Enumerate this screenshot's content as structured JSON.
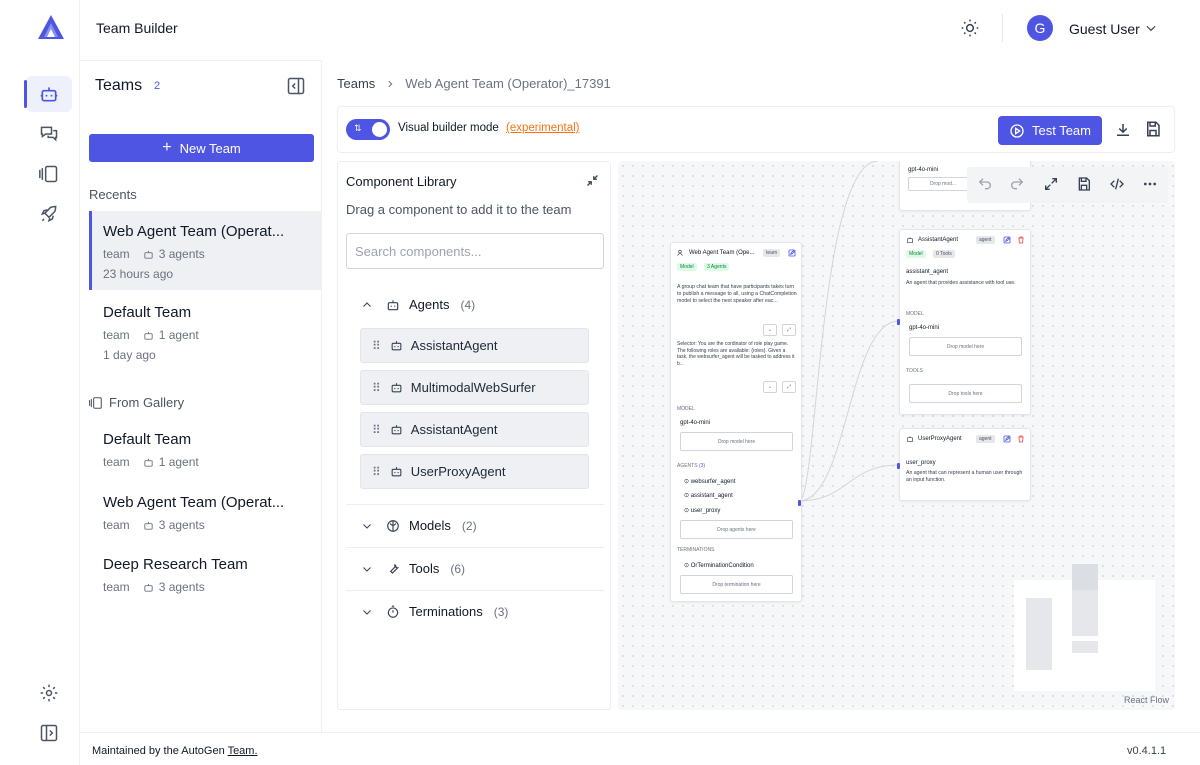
{
  "app": {
    "title": "Team Builder"
  },
  "user": {
    "initial": "G",
    "name": "Guest User"
  },
  "teams": {
    "title": "Teams",
    "count": "2",
    "new_team_label": "New Team",
    "recents_label": "Recents",
    "gallery_label": "From Gallery",
    "recents": [
      {
        "name": "Web Agent Team (Operat...",
        "type": "team",
        "agents": "3 agents",
        "time": "23 hours ago"
      },
      {
        "name": "Default Team",
        "type": "team",
        "agents": "1 agent",
        "time": "1 day ago"
      }
    ],
    "gallery": [
      {
        "name": "Default Team",
        "type": "team",
        "agents": "1 agent"
      },
      {
        "name": "Web Agent Team (Operat...",
        "type": "team",
        "agents": "3 agents"
      },
      {
        "name": "Deep Research Team",
        "type": "team",
        "agents": "3 agents"
      }
    ]
  },
  "breadcrumb": {
    "root": "Teams",
    "current": "Web Agent Team (Operator)_17391"
  },
  "toolbar": {
    "mode_label": "Visual builder mode",
    "mode_tag": "(experimental)",
    "test_label": "Test Team"
  },
  "library": {
    "title": "Component Library",
    "subtitle": "Drag a component to add it to the team",
    "search_placeholder": "Search components...",
    "categories": [
      {
        "label": "Agents",
        "count": "(4)"
      },
      {
        "label": "Models",
        "count": "(2)"
      },
      {
        "label": "Tools",
        "count": "(6)"
      },
      {
        "label": "Terminations",
        "count": "(3)"
      }
    ],
    "agents": [
      "AssistantAgent",
      "MultimodalWebSurfer",
      "AssistantAgent",
      "UserProxyAgent"
    ]
  },
  "canvas": {
    "team_node": {
      "title": "Web Agent Team (Ope...",
      "tag": "team",
      "model_pill": "Model",
      "agents_pill": "3 Agents",
      "desc": "A group chat team that have participants takes turn to publish a message to all, using a ChatCompletion model to select the next speaker after eac...",
      "selector": "Selector: You are the cordinator of role play game. The following roles are available: {roles}. Given a task, the websurfer_agent will be tasked to address it b...",
      "model_label": "MODEL",
      "model_value": "gpt-4o-mini",
      "drop_model": "Drop model here",
      "agents_label": "AGENTS",
      "agents_count": "(3)",
      "agents": [
        "websurfer_agent",
        "assistant_agent",
        "user_proxy"
      ],
      "drop_agents": "Drop agents here",
      "term_label": "TERMINATIONS",
      "term_value": "OrTerminationCondition",
      "drop_term": "Drop termination here"
    },
    "top_node": {
      "model_value": "gpt-4o-mini",
      "drop_model": "Drop mod..."
    },
    "assistant_node": {
      "title": "AssistantAgent",
      "tag": "agent",
      "model_pill": "Model",
      "tools_pill": "0 Tools",
      "name": "assistant_agent",
      "desc": "An agent that provides assistance with tool use.",
      "model_label": "MODEL",
      "model_value": "gpt-4o-mini",
      "drop_model": "Drop model here",
      "tools_label": "TOOLS",
      "drop_tools": "Drop tools here"
    },
    "proxy_node": {
      "title": "UserProxyAgent",
      "tag": "agent",
      "name": "user_proxy",
      "desc": "An agent that can represent a human user through an input function."
    },
    "attribution": "React Flow"
  },
  "footer": {
    "text": "Maintained by the AutoGen ",
    "link": "Team.",
    "version": "v0.4.1.1"
  },
  "colors": {
    "accent": "#4f55e3",
    "experimental": "#f97316"
  }
}
